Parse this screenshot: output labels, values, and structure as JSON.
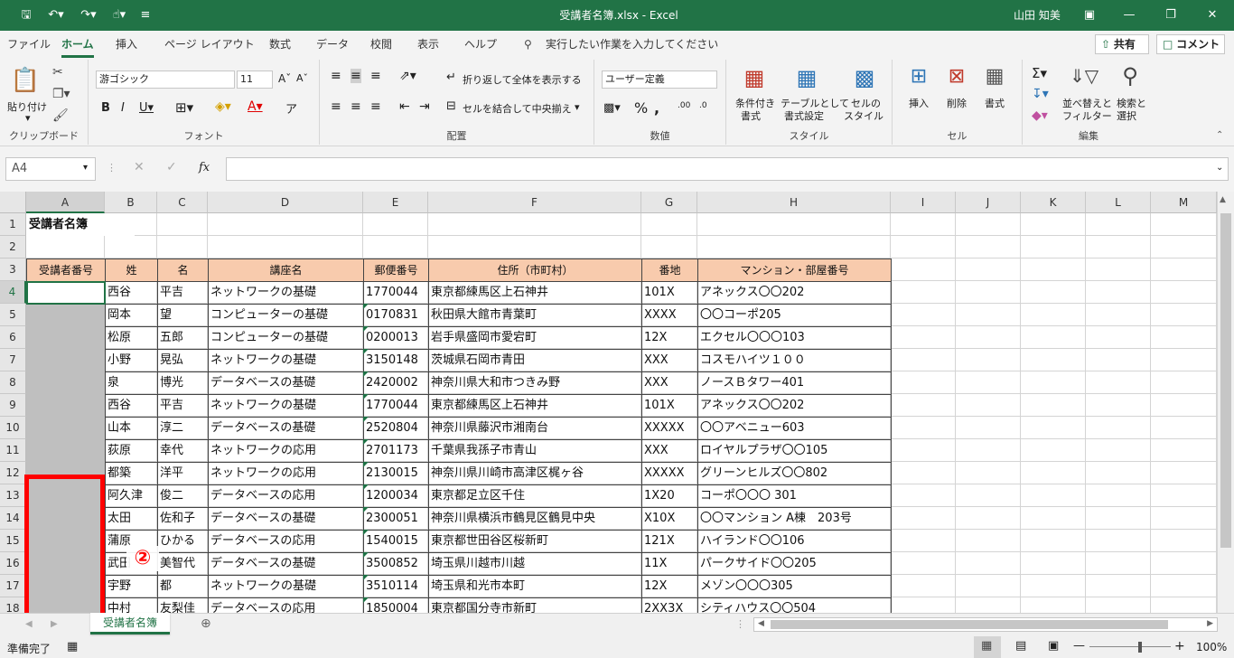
{
  "titlebar": {
    "title": "受講者名簿.xlsx  -  Excel",
    "user": "山田 知美"
  },
  "menu": {
    "tabs": [
      "ファイル",
      "ホーム",
      "挿入",
      "ページ レイアウト",
      "数式",
      "データ",
      "校閲",
      "表示",
      "ヘルプ"
    ],
    "tell_me": "実行したい作業を入力してください",
    "share": "共有",
    "comments": "コメント"
  },
  "ribbon": {
    "paste": "貼り付け",
    "clipboard_label": "クリップボード",
    "font_name": "游ゴシック",
    "font_size": "11",
    "font_label": "フォント",
    "wrap_text": "折り返して全体を表示する",
    "merge_center": "セルを結合して中央揃え",
    "alignment_label": "配置",
    "number_format": "ユーザー定義",
    "number_label": "数値",
    "conditional": "条件付き",
    "conditional2": "書式",
    "table_format": "テーブルとして",
    "table_format2": "書式設定",
    "cell_style": "セルの",
    "cell_style2": "スタイル",
    "styles_label": "スタイル",
    "insert": "挿入",
    "delete": "削除",
    "format": "書式",
    "cells_label": "セル",
    "sort_filter": "並べ替えと",
    "sort_filter2": "フィルター",
    "find_select": "検索と",
    "find_select2": "選択",
    "editing_label": "編集"
  },
  "formula": {
    "name_box": "A4",
    "fx": "fx",
    "value": ""
  },
  "columns": [
    "A",
    "B",
    "C",
    "D",
    "E",
    "F",
    "G",
    "H",
    "I",
    "J",
    "K",
    "L",
    "M"
  ],
  "rows": [
    "1",
    "2",
    "3",
    "4",
    "5",
    "6",
    "7",
    "8",
    "9",
    "10",
    "11",
    "12",
    "13",
    "14",
    "15",
    "16",
    "17",
    "18"
  ],
  "sheet_title": "受講者名簿",
  "headers": [
    "受講者番号",
    "姓",
    "名",
    "講座名",
    "郵便番号",
    "住所（市町村）",
    "番地",
    "マンション・部屋番号"
  ],
  "data": [
    [
      "",
      "西谷",
      "平吉",
      "ネットワークの基礎",
      "1770044",
      "東京都練馬区上石神井",
      "101X",
      "アネックス〇〇202"
    ],
    [
      "",
      "岡本",
      "望",
      "コンピューターの基礎",
      "0170831",
      "秋田県大館市青葉町",
      "XXXX",
      "〇〇コーポ205"
    ],
    [
      "",
      "松原",
      "五郎",
      "コンピューターの基礎",
      "0200013",
      "岩手県盛岡市愛宕町",
      "12X",
      "エクセル〇〇〇103"
    ],
    [
      "",
      "小野",
      "晃弘",
      "ネットワークの基礎",
      "3150148",
      "茨城県石岡市青田",
      "XXX",
      "コスモハイツ１００"
    ],
    [
      "",
      "泉",
      "博光",
      "データベースの基礎",
      "2420002",
      "神奈川県大和市つきみ野",
      "XXX",
      "ノースＢタワー401"
    ],
    [
      "",
      "西谷",
      "平吉",
      "ネットワークの基礎",
      "1770044",
      "東京都練馬区上石神井",
      "101X",
      "アネックス〇〇202"
    ],
    [
      "",
      "山本",
      "淳二",
      "データベースの基礎",
      "2520804",
      "神奈川県藤沢市湘南台",
      "XXXXX",
      "〇〇アベニュー603"
    ],
    [
      "",
      "荻原",
      "幸代",
      "ネットワークの応用",
      "2701173",
      "千葉県我孫子市青山",
      "XXX",
      "ロイヤルプラザ〇〇105"
    ],
    [
      "",
      "都築",
      "洋平",
      "ネットワークの応用",
      "2130015",
      "神奈川県川崎市高津区梶ヶ谷",
      "XXXXX",
      "グリーンヒルズ〇〇802"
    ],
    [
      "",
      "阿久津",
      "俊二",
      "データベースの応用",
      "1200034",
      "東京都足立区千住",
      "1X20",
      "コーポ〇〇〇 301"
    ],
    [
      "",
      "太田",
      "佐和子",
      "データベースの基礎",
      "2300051",
      "神奈川県横浜市鶴見区鶴見中央",
      "X10X",
      "〇〇マンション A棟　203号"
    ],
    [
      "",
      "蒲原",
      "ひかる",
      "データベースの応用",
      "1540015",
      "東京都世田谷区桜新町",
      "121X",
      "ハイランド〇〇106"
    ],
    [
      "",
      "武田",
      "美智代",
      "データベースの基礎",
      "3500852",
      "埼玉県川越市川越",
      "11X",
      "パークサイド〇〇205"
    ],
    [
      "",
      "宇野",
      "都",
      "ネットワークの基礎",
      "3510114",
      "埼玉県和光市本町",
      "12X",
      "メゾン〇〇〇305"
    ],
    [
      "",
      "中村",
      "友梨佳",
      "データベースの応用",
      "1850004",
      "東京都国分寺市新町",
      "2XX3X",
      "シティハウス〇〇504"
    ]
  ],
  "callout": "②",
  "sheet_tab": "受講者名簿",
  "status": {
    "ready": "準備完了",
    "zoom": "100%"
  }
}
